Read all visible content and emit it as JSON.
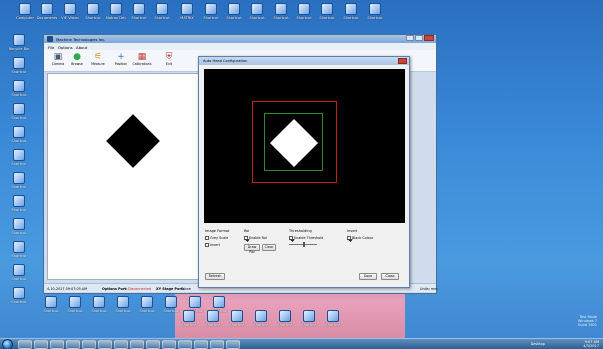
{
  "desktop": {
    "top_icons": [
      {
        "label": "Computer"
      },
      {
        "label": "Documents"
      },
      {
        "label": "VIE Vision"
      },
      {
        "label": "Shortcut"
      },
      {
        "label": "Matrox Dev"
      },
      {
        "label": "Shortcut"
      },
      {
        "label": "Shortcut"
      },
      {
        "label": "MATRIX"
      },
      {
        "label": "Shortcut"
      },
      {
        "label": "Shortcut"
      },
      {
        "label": "Shortcut"
      },
      {
        "label": "Shortcut"
      },
      {
        "label": "Shortcut"
      },
      {
        "label": "Shortcut"
      },
      {
        "label": "Shortcut"
      },
      {
        "label": "Shortcut"
      }
    ],
    "left_icons": [
      {
        "label": "Recycle Bin"
      },
      {
        "label": "Shortcut"
      },
      {
        "label": "Shortcut"
      },
      {
        "label": "Shortcut"
      },
      {
        "label": "Shortcut"
      },
      {
        "label": "Shortcut"
      },
      {
        "label": "Shortcut"
      },
      {
        "label": "Shortcut"
      },
      {
        "label": "Shortcut"
      },
      {
        "label": "Shortcut"
      },
      {
        "label": "Shortcut"
      },
      {
        "label": "Shortcut"
      }
    ],
    "bottom_icons": [
      {
        "label": "Shortcut"
      },
      {
        "label": "Shortcut"
      },
      {
        "label": "Shortcut"
      },
      {
        "label": "Shortcut"
      },
      {
        "label": "Shortcut"
      },
      {
        "label": "Shortcut"
      },
      {
        "label": "Shortcut"
      },
      {
        "label": "Shortcut"
      },
      {
        "label": "Shortcut"
      },
      {
        "label": "Shortcut"
      },
      {
        "label": "Shortcut"
      },
      {
        "label": "Shortcut"
      },
      {
        "label": "Shortcut"
      },
      {
        "label": "Shortcut"
      },
      {
        "label": "Shortcut"
      }
    ],
    "watermark": "Test Mode\nWindows 7\nBuild 7601"
  },
  "taskbar": {
    "tray_time": "9:07 AM",
    "tray_date": "4/3/2017",
    "desktop_label": "Desktop"
  },
  "main_window": {
    "title": "Machine Technologies Inc.",
    "menu": [
      "File",
      "Options",
      "About"
    ],
    "toolbar": [
      {
        "label": "Camera",
        "icon": "camera-icon",
        "glyph": "▣",
        "color": "#4a5b6e"
      },
      {
        "label": "Browse",
        "icon": "browse-icon",
        "glyph": "●",
        "color": "#2fa84f"
      },
      {
        "label": "Measure",
        "icon": "measure-icon",
        "glyph": "⚟",
        "color": "#e08a1e"
      },
      {
        "label": "Position",
        "icon": "position-icon",
        "glyph": "+",
        "color": "#3c6fc2"
      },
      {
        "label": "Calibrations",
        "icon": "calibration-icon",
        "glyph": "▦",
        "color": "#c23b3b"
      },
      {
        "label": "Exit",
        "icon": "exit-icon",
        "glyph": "⛨",
        "color": "#c23b3b"
      }
    ],
    "status": {
      "left": "4-10-2017 09:07:05 AM",
      "options_port_label": "Options Port:",
      "options_port_value": "Disconnected",
      "xy_stage_label": "XY Stage Port:",
      "xy_stage_value": "None",
      "units": "Units: mm"
    }
  },
  "dialog": {
    "title": "Auto Head Configuration",
    "groups": {
      "image_format": {
        "title": "Image Format",
        "options": [
          {
            "label": "Grey Scale",
            "checked": false
          },
          {
            "label": "Invert",
            "checked": false
          }
        ]
      },
      "roi": {
        "title": "Roi",
        "options": [
          {
            "label": "Enable Roi",
            "checked": true
          }
        ],
        "buttons": [
          "Draw Roi",
          "Clear"
        ]
      },
      "thresholding": {
        "title": "Thresholding",
        "options": [
          {
            "label": "Enable Threshold",
            "checked": true
          }
        ],
        "slider_level": 0.55
      },
      "invert": {
        "title": "Invert",
        "options": [
          {
            "label": "Black Colour",
            "checked": true
          }
        ]
      }
    },
    "buttons": {
      "refresh": "Refresh",
      "save": "Save",
      "close": "Close"
    }
  }
}
